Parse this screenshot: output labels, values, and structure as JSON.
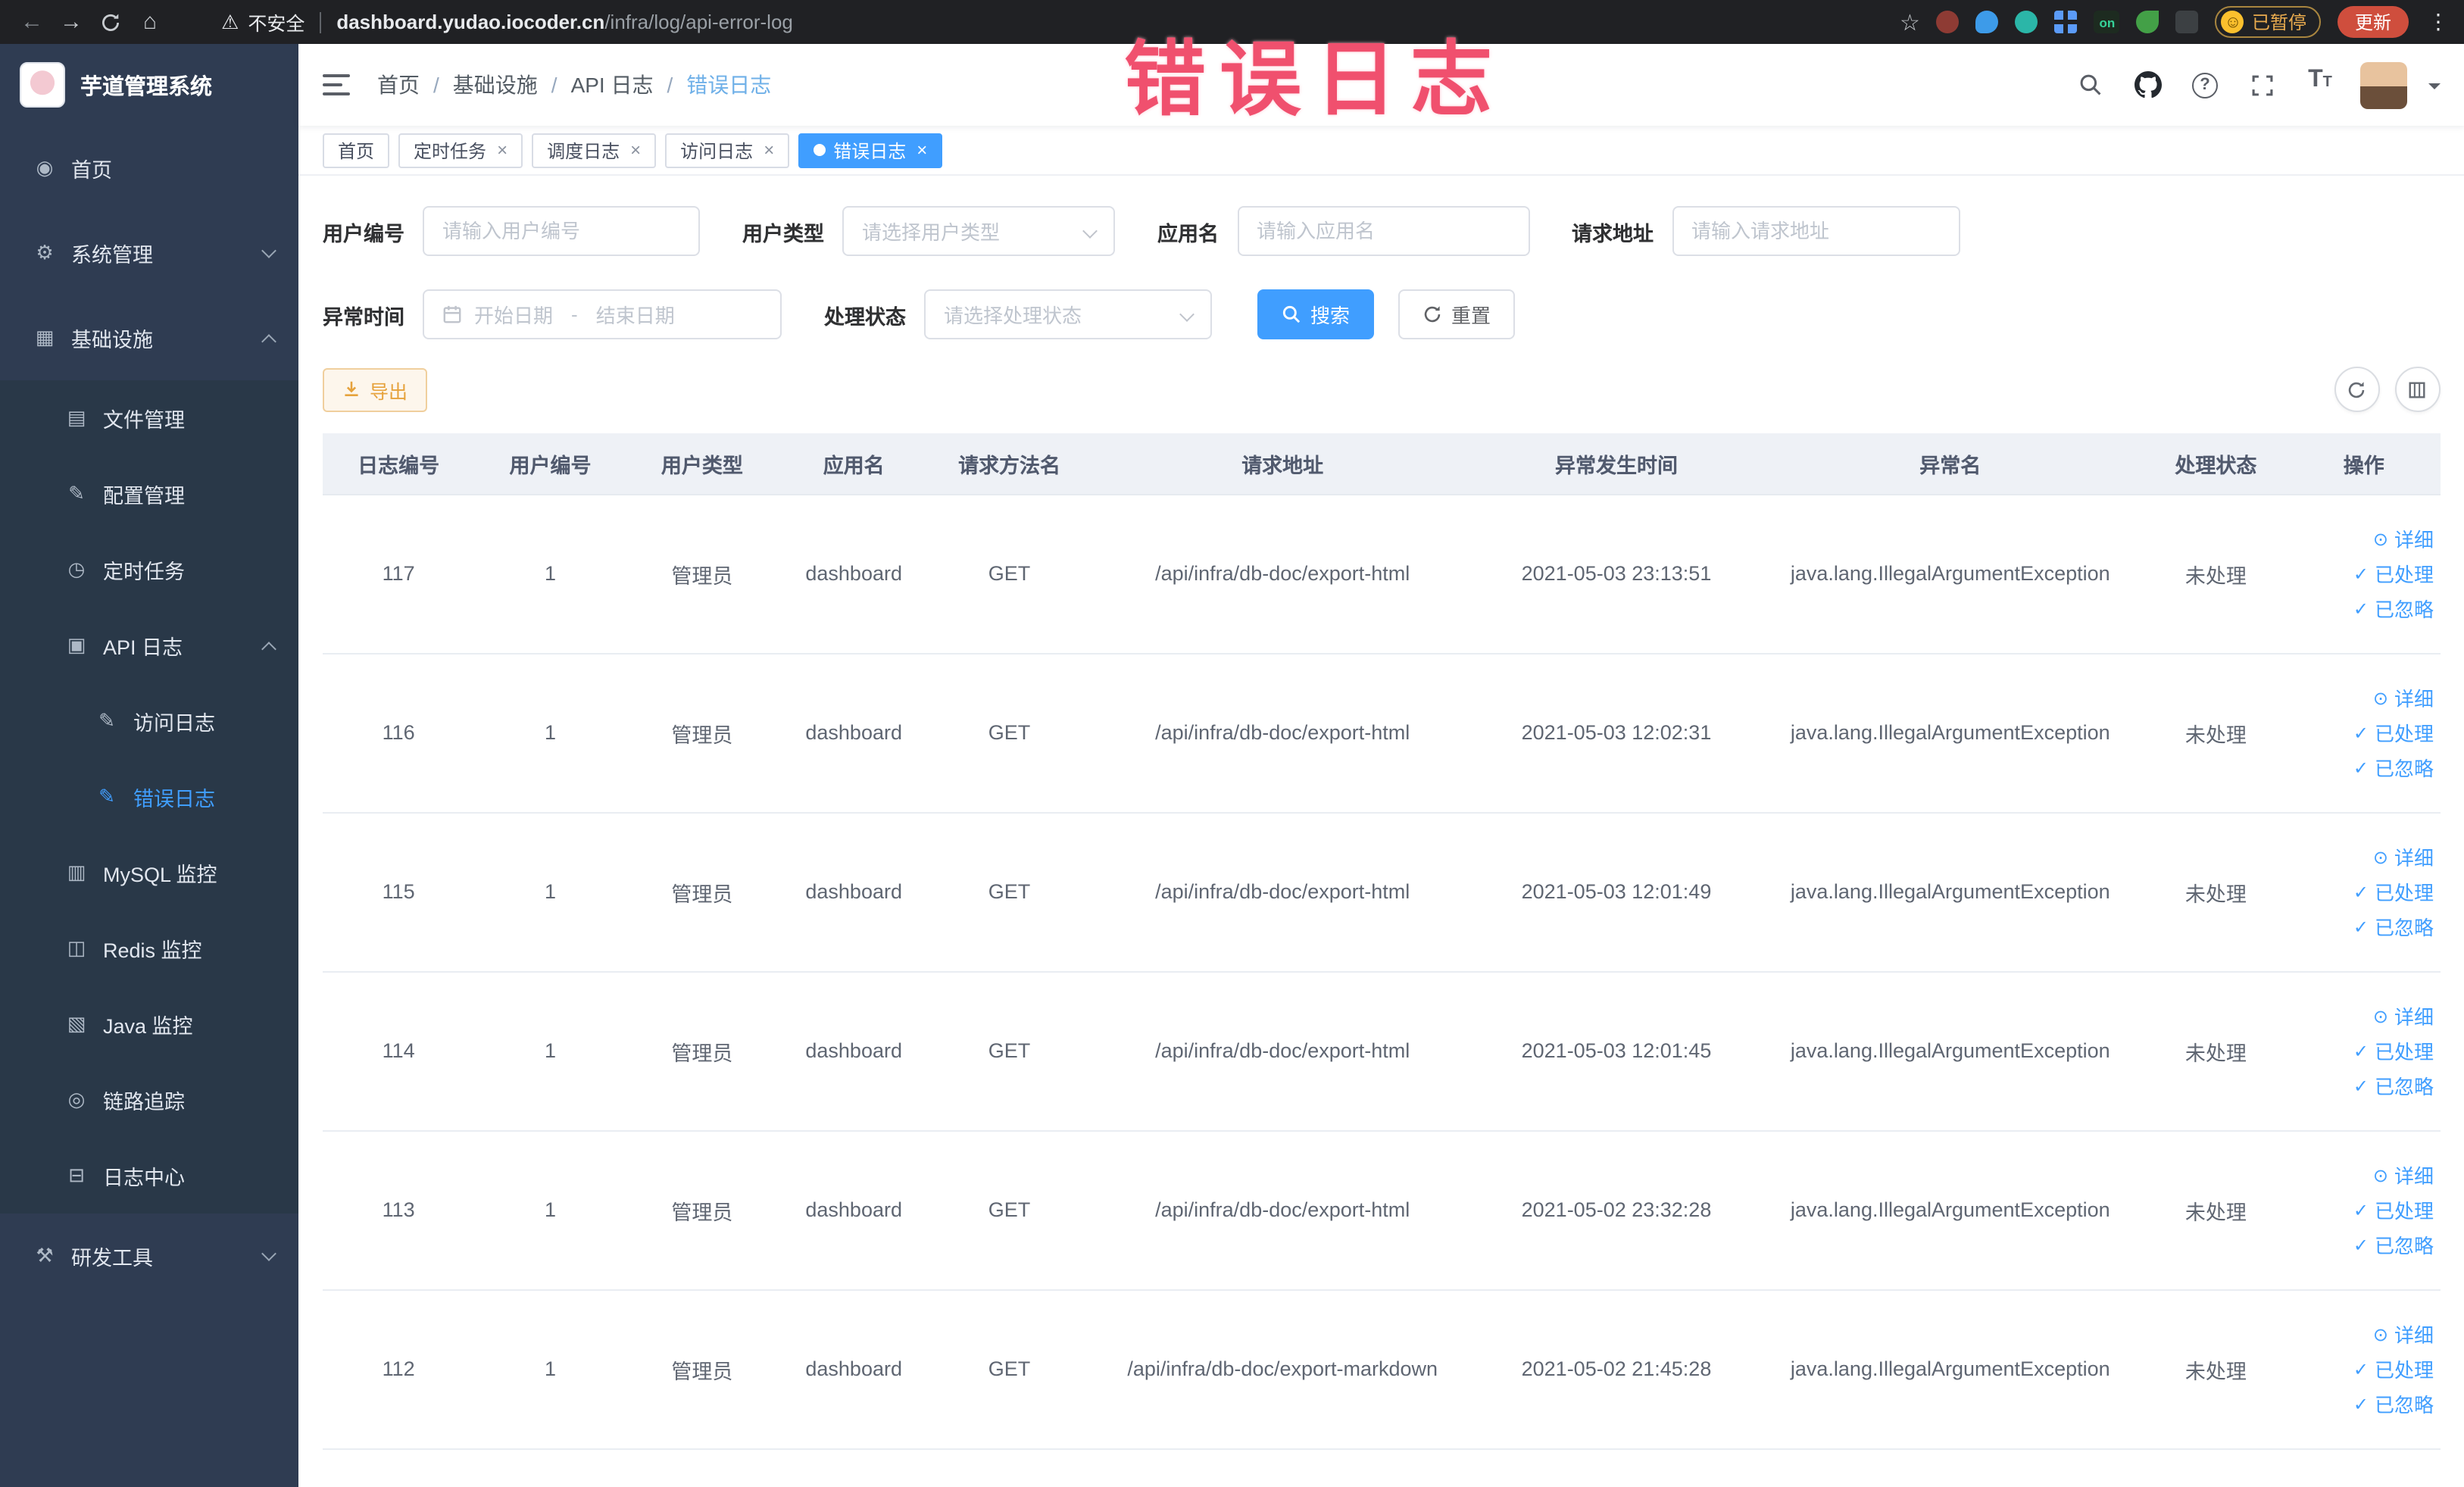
{
  "annotation": {
    "text": "错误日志"
  },
  "browser": {
    "security_label": "不安全",
    "url_host": "dashboard.yudao.iocoder.cn",
    "url_path": "/infra/log/api-error-log",
    "extension_on_label": "on",
    "paused_label": "已暂停",
    "update_label": "更新"
  },
  "sidebar": {
    "logo_title": "芋道管理系统",
    "items": [
      {
        "label": "首页"
      },
      {
        "label": "系统管理"
      },
      {
        "label": "基础设施"
      },
      {
        "label": "文件管理"
      },
      {
        "label": "配置管理"
      },
      {
        "label": "定时任务"
      },
      {
        "label": "API 日志"
      },
      {
        "label": "访问日志"
      },
      {
        "label": "错误日志"
      },
      {
        "label": "MySQL 监控"
      },
      {
        "label": "Redis 监控"
      },
      {
        "label": "Java 监控"
      },
      {
        "label": "链路追踪"
      },
      {
        "label": "日志中心"
      },
      {
        "label": "研发工具"
      }
    ]
  },
  "breadcrumb": {
    "items": [
      "首页",
      "基础设施",
      "API 日志",
      "错误日志"
    ]
  },
  "tabs": [
    {
      "label": "首页"
    },
    {
      "label": "定时任务"
    },
    {
      "label": "调度日志"
    },
    {
      "label": "访问日志"
    },
    {
      "label": "错误日志"
    }
  ],
  "filters": {
    "user_id_label": "用户编号",
    "user_id_placeholder": "请输入用户编号",
    "user_type_label": "用户类型",
    "user_type_placeholder": "请选择用户类型",
    "app_name_label": "应用名",
    "app_name_placeholder": "请输入应用名",
    "request_url_label": "请求地址",
    "request_url_placeholder": "请输入请求地址",
    "exception_time_label": "异常时间",
    "date_start_placeholder": "开始日期",
    "date_separator": "-",
    "date_end_placeholder": "结束日期",
    "process_status_label": "处理状态",
    "process_status_placeholder": "请选择处理状态",
    "search_label": "搜索",
    "reset_label": "重置"
  },
  "toolbar": {
    "export_label": "导出"
  },
  "table": {
    "columns": [
      "日志编号",
      "用户编号",
      "用户类型",
      "应用名",
      "请求方法名",
      "请求地址",
      "异常发生时间",
      "异常名",
      "处理状态",
      "操作"
    ],
    "action_detail": "详细",
    "action_processed": "已处理",
    "action_ignored": "已忽略",
    "rows": [
      {
        "id": "117",
        "user_id": "1",
        "user_type": "管理员",
        "app": "dashboard",
        "method": "GET",
        "url": "/api/infra/db-doc/export-html",
        "time": "2021-05-03 23:13:51",
        "exception": "java.lang.IllegalArgumentException",
        "status": "未处理"
      },
      {
        "id": "116",
        "user_id": "1",
        "user_type": "管理员",
        "app": "dashboard",
        "method": "GET",
        "url": "/api/infra/db-doc/export-html",
        "time": "2021-05-03 12:02:31",
        "exception": "java.lang.IllegalArgumentException",
        "status": "未处理"
      },
      {
        "id": "115",
        "user_id": "1",
        "user_type": "管理员",
        "app": "dashboard",
        "method": "GET",
        "url": "/api/infra/db-doc/export-html",
        "time": "2021-05-03 12:01:49",
        "exception": "java.lang.IllegalArgumentException",
        "status": "未处理"
      },
      {
        "id": "114",
        "user_id": "1",
        "user_type": "管理员",
        "app": "dashboard",
        "method": "GET",
        "url": "/api/infra/db-doc/export-html",
        "time": "2021-05-03 12:01:45",
        "exception": "java.lang.IllegalArgumentException",
        "status": "未处理"
      },
      {
        "id": "113",
        "user_id": "1",
        "user_type": "管理员",
        "app": "dashboard",
        "method": "GET",
        "url": "/api/infra/db-doc/export-html",
        "time": "2021-05-02 23:32:28",
        "exception": "java.lang.IllegalArgumentException",
        "status": "未处理"
      },
      {
        "id": "112",
        "user_id": "1",
        "user_type": "管理员",
        "app": "dashboard",
        "method": "GET",
        "url": "/api/infra/db-doc/export-markdown",
        "time": "2021-05-02 21:45:28",
        "exception": "java.lang.IllegalArgumentException",
        "status": "未处理"
      }
    ]
  }
}
